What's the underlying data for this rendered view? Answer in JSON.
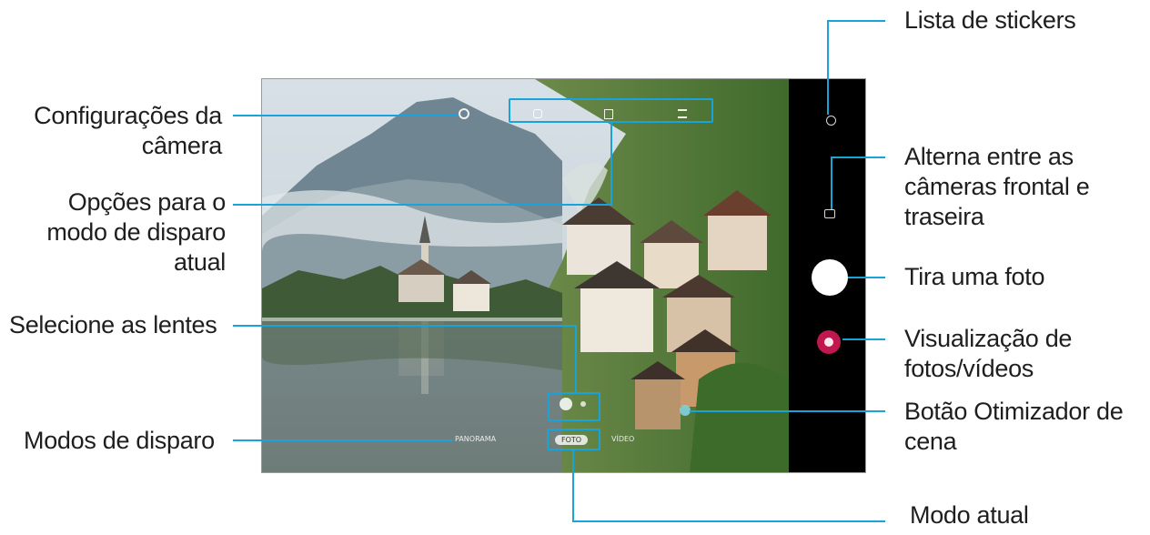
{
  "callouts": {
    "camera_settings": [
      "Configurações da",
      "câmera"
    ],
    "shooting_options": [
      "Opções para o",
      "modo de disparo",
      "atual"
    ],
    "select_lens": "Selecione as lentes",
    "shooting_modes": "Modos de disparo",
    "sticker_list": "Lista de stickers",
    "switch_cameras": [
      "Alterna entre as",
      "câmeras frontal e",
      "traseira"
    ],
    "take_photo": "Tira uma foto",
    "preview_media": [
      "Visualização de",
      "fotos/vídeos"
    ],
    "scene_optimizer": [
      "Botão Otimizador de",
      "cena"
    ],
    "current_mode": "Modo atual"
  },
  "viewfinder": {
    "mode_strip": {
      "modes": [
        "PANORAMA",
        "FOTO",
        "VÍDEO"
      ],
      "current_mode": "FOTO"
    }
  },
  "colors": {
    "accent": "#1aa3d8",
    "shutter": "#ffffff",
    "gallery_thumbnail": "#c0174f",
    "side_panel": "#000000"
  },
  "icons": {
    "camera_settings": "gear-icon",
    "flash": "flash-icon",
    "aspect_ratio": "ratio-icon",
    "filters": "filter-icon",
    "sticker_list": "sticker-icon",
    "switch_cameras": "switch-camera-icon",
    "shutter": "shutter-button",
    "gallery": "gallery-thumbnail",
    "scene_optimizer": "scene-optimizer-icon"
  }
}
